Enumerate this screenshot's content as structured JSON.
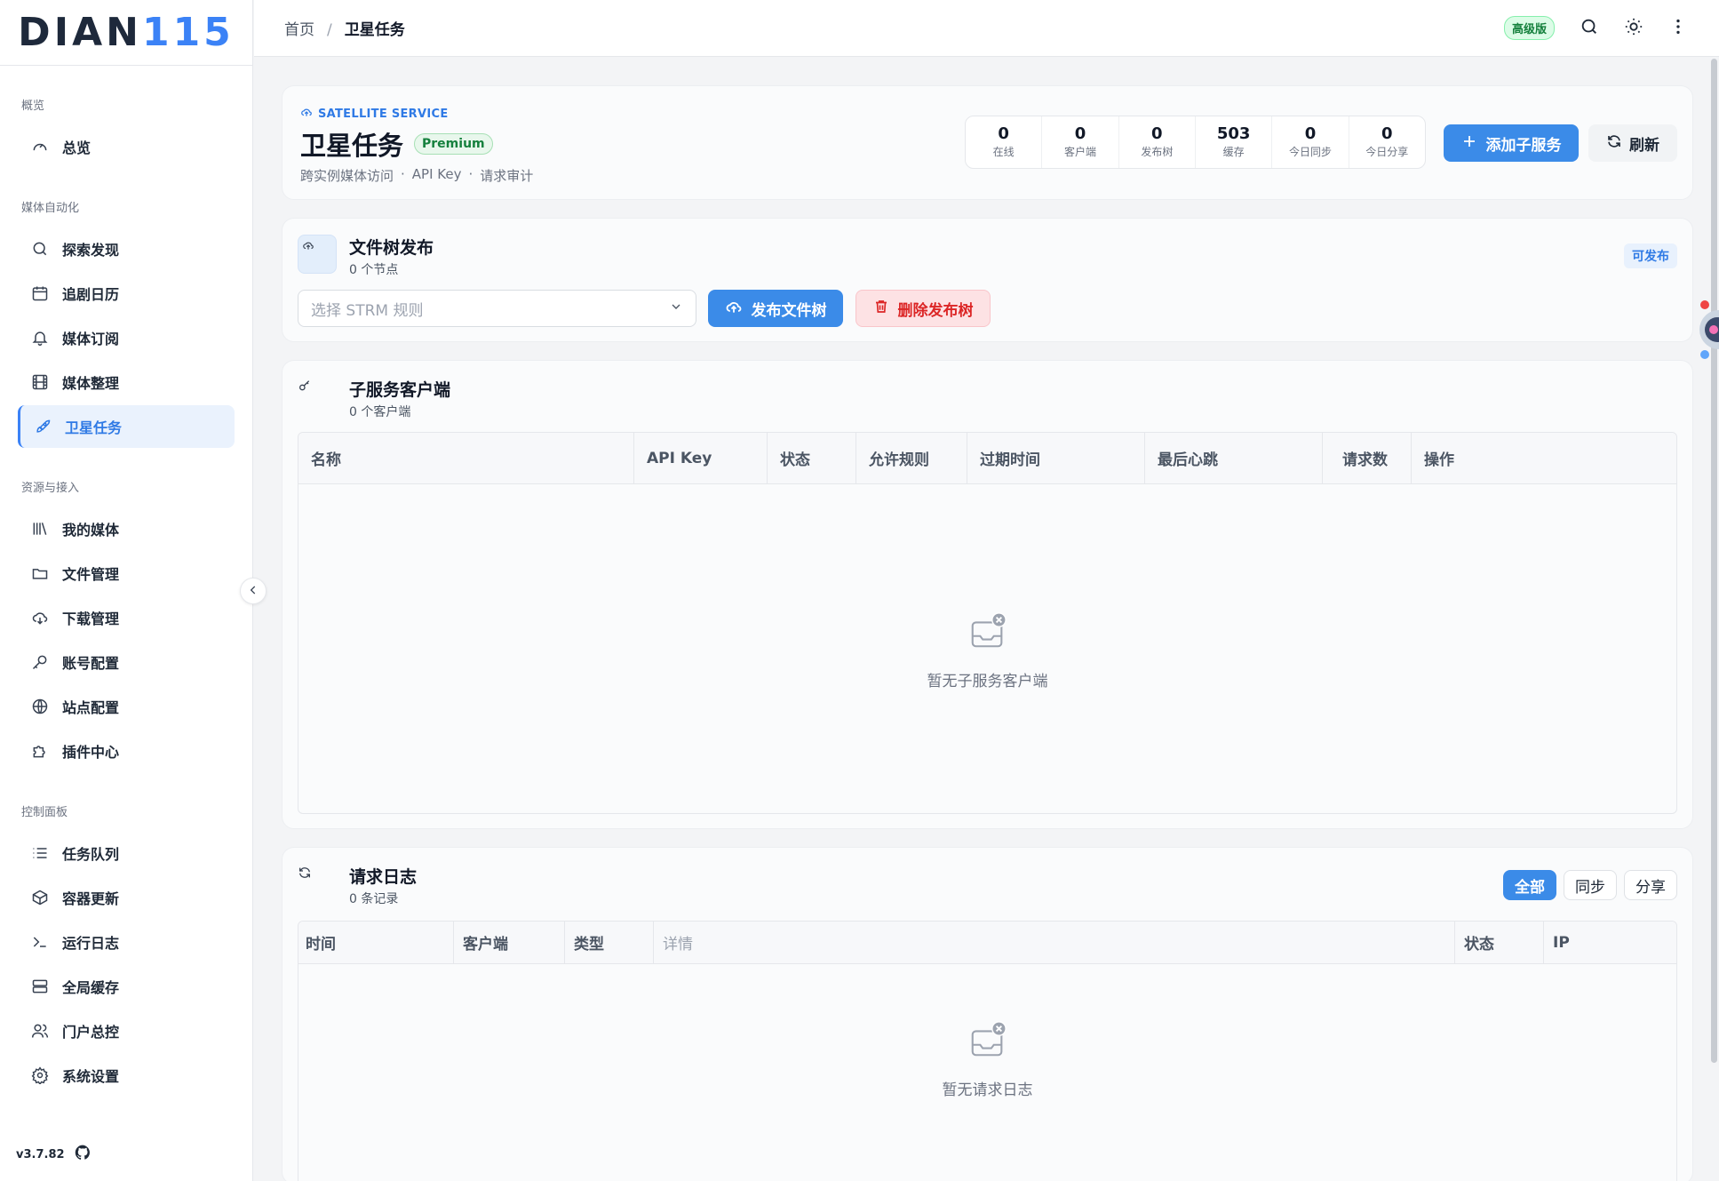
{
  "brand": {
    "logo_main": "DIAN",
    "logo_accent": "115",
    "version": "v3.7.82"
  },
  "sidebar": {
    "groups": [
      {
        "label": "概览",
        "items": [
          {
            "label": "总览",
            "icon": "gauge-icon"
          }
        ]
      },
      {
        "label": "媒体自动化",
        "items": [
          {
            "label": "探索发现",
            "icon": "search-icon"
          },
          {
            "label": "追剧日历",
            "icon": "calendar-icon"
          },
          {
            "label": "媒体订阅",
            "icon": "bell-icon"
          },
          {
            "label": "媒体整理",
            "icon": "film-icon"
          },
          {
            "label": "卫星任务",
            "icon": "rocket-icon"
          }
        ]
      },
      {
        "label": "资源与接入",
        "items": [
          {
            "label": "我的媒体",
            "icon": "library-icon"
          },
          {
            "label": "文件管理",
            "icon": "folder-icon"
          },
          {
            "label": "下载管理",
            "icon": "cloud-download-icon"
          },
          {
            "label": "账号配置",
            "icon": "key-icon"
          },
          {
            "label": "站点配置",
            "icon": "globe-icon"
          },
          {
            "label": "插件中心",
            "icon": "puzzle-icon"
          }
        ]
      },
      {
        "label": "控制面板",
        "items": [
          {
            "label": "任务队列",
            "icon": "list-icon"
          },
          {
            "label": "容器更新",
            "icon": "box-icon"
          },
          {
            "label": "运行日志",
            "icon": "terminal-icon"
          },
          {
            "label": "全局缓存",
            "icon": "server-icon"
          },
          {
            "label": "门户总控",
            "icon": "users-icon"
          },
          {
            "label": "系统设置",
            "icon": "gear-icon"
          }
        ]
      }
    ]
  },
  "topbar": {
    "breadcrumb_home": "首页",
    "breadcrumb_sep": "/",
    "breadcrumb_current": "卫星任务",
    "edition": "高级版"
  },
  "service": {
    "label": "SATELLITE SERVICE",
    "title": "卫星任务",
    "tier": "Premium",
    "subtitle": [
      "跨实例媒体访问",
      "·",
      "API Key",
      "·",
      "请求审计"
    ],
    "stats": [
      {
        "value": "0",
        "label": "在线"
      },
      {
        "value": "0",
        "label": "客户端"
      },
      {
        "value": "0",
        "label": "发布树"
      },
      {
        "value": "503",
        "label": "缓存"
      },
      {
        "value": "0",
        "label": "今日同步"
      },
      {
        "value": "0",
        "label": "今日分享"
      }
    ],
    "add_label": "添加子服务",
    "refresh_label": "刷新"
  },
  "publish": {
    "title": "文件树发布",
    "subtitle": "0 个节点",
    "tag": "可发布",
    "select_placeholder": "选择 STRM 规则",
    "publish_label": "发布文件树",
    "delete_label": "删除发布树"
  },
  "clients": {
    "title": "子服务客户端",
    "subtitle": "0 个客户端",
    "columns": [
      "名称",
      "API Key",
      "状态",
      "允许规则",
      "过期时间",
      "最后心跳",
      "请求数",
      "操作"
    ],
    "empty": "暂无子服务客户端"
  },
  "logs": {
    "title": "请求日志",
    "subtitle": "0 条记录",
    "filters": [
      "全部",
      "同步",
      "分享"
    ],
    "columns": [
      "时间",
      "客户端",
      "类型",
      "详情",
      "状态",
      "IP"
    ],
    "empty": "暂无请求日志"
  },
  "colors": {
    "accent": "#3b8be8",
    "danger": "#dc2626",
    "success": "#15803d"
  }
}
